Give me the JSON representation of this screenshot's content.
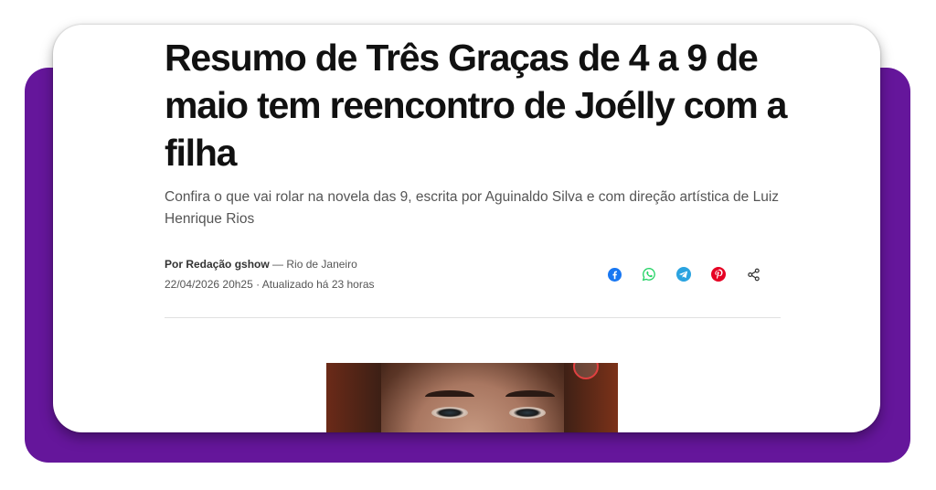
{
  "article": {
    "headline": "Resumo de Três Graças de 4 a 9 de maio tem reencontro de Joélly com a filha",
    "subtitle": "Confira o que vai rolar na novela das 9, escrita por Aguinaldo Silva e com direção artística de Luiz Henrique Rios",
    "byline": {
      "author": "Por Redação gshow",
      "location": "— Rio de Janeiro",
      "timestamp": "22/04/2026 20h25 · Atualizado há 23 horas"
    }
  },
  "share": {
    "icons": [
      "facebook-icon",
      "whatsapp-icon",
      "telegram-icon",
      "pinterest-icon",
      "share-icon"
    ],
    "colors": {
      "facebook": "#1877f2",
      "whatsapp": "#25d366",
      "telegram": "#2aa3e0",
      "pinterest": "#e60023",
      "share": "#333333"
    }
  },
  "theme": {
    "frame_color": "#65169b",
    "card_color": "#ffffff"
  }
}
